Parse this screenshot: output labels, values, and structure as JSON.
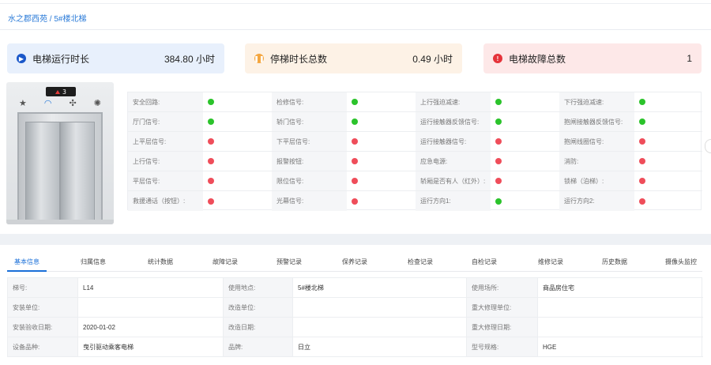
{
  "breadcrumb": "水之郡西苑 / 5#楼北梯",
  "summary": {
    "run_time": {
      "label": "电梯运行时长",
      "value": "384.80 小时",
      "icon": "play-icon",
      "color": "#1a57c9"
    },
    "stop_time": {
      "label": "停梯时长总数",
      "value": "0.49 小时",
      "icon": "pause-icon",
      "color": "#f4a640"
    },
    "fault_count": {
      "label": "电梯故障总数",
      "value": "1",
      "icon": "alert-icon",
      "color": "#e5333a"
    }
  },
  "elevator": {
    "floor": "3",
    "direction": "up"
  },
  "signals": [
    [
      {
        "label": "安全回路:",
        "status": "green"
      },
      {
        "label": "检修信号:",
        "status": "green"
      },
      {
        "label": "上行强迫减速:",
        "status": "green"
      },
      {
        "label": "下行强迫减速:",
        "status": "green"
      }
    ],
    [
      {
        "label": "厅门信号:",
        "status": "green"
      },
      {
        "label": "轿门信号:",
        "status": "green"
      },
      {
        "label": "运行接触器反馈信号:",
        "status": "green"
      },
      {
        "label": "抱闸接触器反馈信号:",
        "status": "green"
      }
    ],
    [
      {
        "label": "上平层信号:",
        "status": "red"
      },
      {
        "label": "下平层信号:",
        "status": "red"
      },
      {
        "label": "运行接触器信号:",
        "status": "red"
      },
      {
        "label": "抱闸线圈信号:",
        "status": "red"
      }
    ],
    [
      {
        "label": "上行信号:",
        "status": "red"
      },
      {
        "label": "报警按钮:",
        "status": "red"
      },
      {
        "label": "应急电源:",
        "status": "red"
      },
      {
        "label": "消防:",
        "status": "red"
      }
    ],
    [
      {
        "label": "平层信号:",
        "status": "red"
      },
      {
        "label": "限位信号:",
        "status": "red"
      },
      {
        "label": "轿厢是否有人（红外）:",
        "status": "red"
      },
      {
        "label": "锁梯（泊梯）:",
        "status": "red"
      }
    ],
    [
      {
        "label": "救援通话（按钮）:",
        "status": "red"
      },
      {
        "label": "光幕信号:",
        "status": "red"
      },
      {
        "label": "运行方向1:",
        "status": "green"
      },
      {
        "label": "运行方向2:",
        "status": "red"
      }
    ]
  ],
  "status_colors": {
    "green": "#2bc32b",
    "red": "#ef4d5a"
  },
  "tabs": [
    "基本信息",
    "归属信息",
    "统计数据",
    "故障记录",
    "预警记录",
    "保养记录",
    "检查记录",
    "自检记录",
    "维修记录",
    "历史数据",
    "摄像头监控"
  ],
  "active_tab": "基本信息",
  "info": [
    [
      "梯号:",
      "L14",
      "使用地点:",
      "5#楼北梯",
      "使用场所:",
      "商品房住宅"
    ],
    [
      "安装单位:",
      "",
      "改造单位:",
      "",
      "重大修理单位:",
      ""
    ],
    [
      "安装验收日期:",
      "2020-01-02",
      "改造日期:",
      "",
      "重大修理日期:",
      ""
    ],
    [
      "设备品种:",
      "曳引驱动乘客电梯",
      "品牌:",
      "日立",
      "型号规格:",
      "HGE"
    ]
  ]
}
